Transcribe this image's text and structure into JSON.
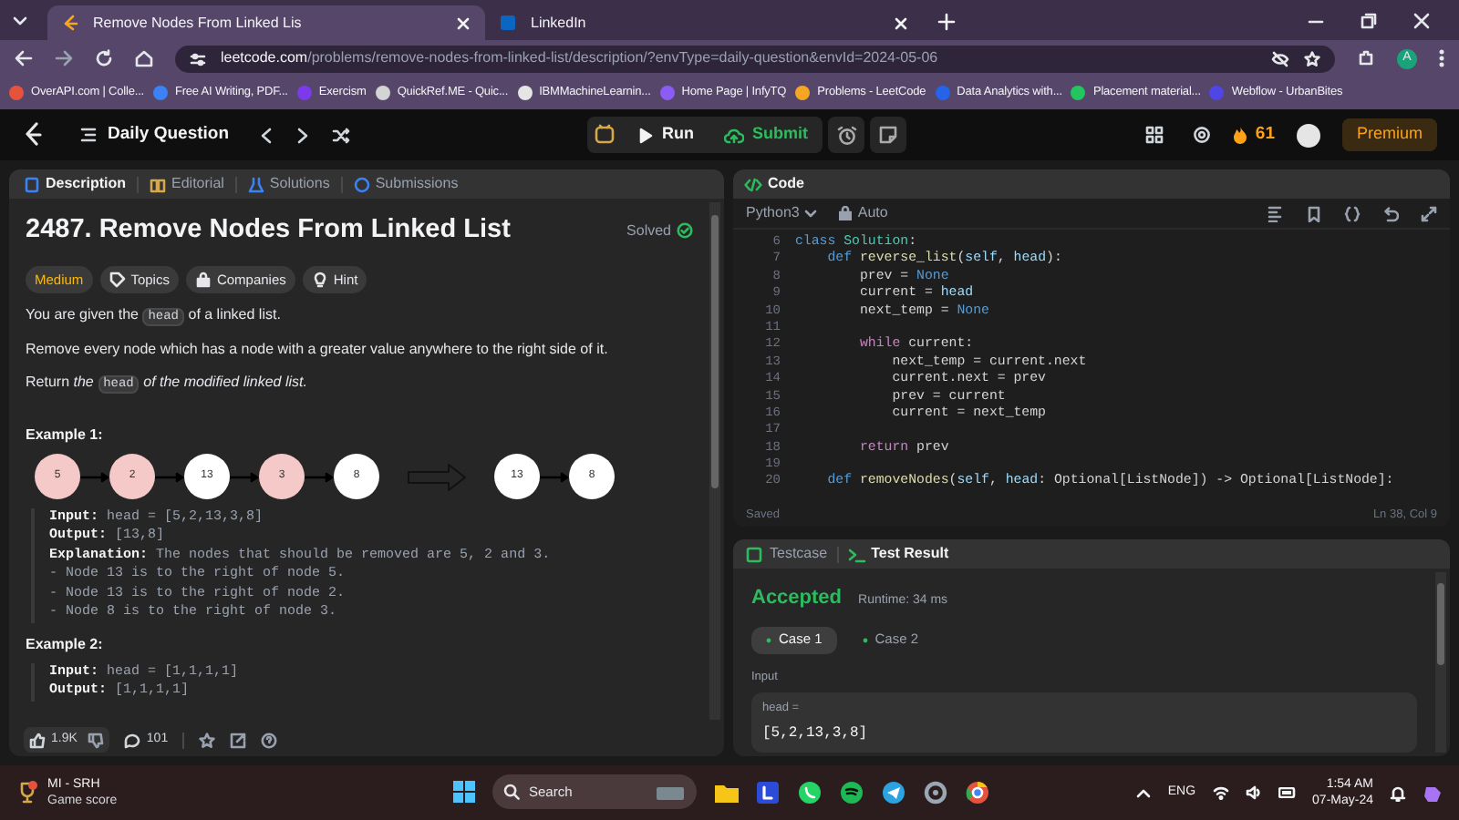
{
  "browser": {
    "tabs": [
      {
        "title": "Remove Nodes From Linked Lis",
        "selected": true
      },
      {
        "title": "LinkedIn",
        "selected": false
      }
    ],
    "url_host": "leetcode.com",
    "url_path": "/problems/remove-nodes-from-linked-list/description/?envType=daily-question&envId=2024-05-06",
    "bookmarks": [
      "OverAPI.com | Colle...",
      "Free AI Writing, PDF...",
      "Exercism",
      "QuickRef.ME - Quic...",
      "IBMMachineLearnin...",
      "Home Page | InfyTQ",
      "Problems - LeetCode",
      "Data Analytics with...",
      "Placement material...",
      "Webflow - UrbanBites"
    ],
    "profile_initial": "A"
  },
  "header": {
    "title": "Daily Question",
    "run": "Run",
    "submit": "Submit",
    "streak": "61",
    "premium": "Premium"
  },
  "left_panel": {
    "tabs": [
      {
        "label": "Description",
        "selected": true
      },
      {
        "label": "Editorial",
        "selected": false
      },
      {
        "label": "Solutions",
        "selected": false
      },
      {
        "label": "Submissions",
        "selected": false
      }
    ],
    "title": "2487. Remove Nodes From Linked List",
    "status": "Solved",
    "tags": [
      {
        "kind": "difficulty",
        "label": "Medium"
      },
      {
        "kind": "topics",
        "label": "Topics"
      },
      {
        "kind": "companies",
        "label": "Companies"
      },
      {
        "kind": "hint",
        "label": "Hint"
      }
    ],
    "paragraphs": [
      [
        {
          "kind": "text",
          "text": "You are given the "
        },
        {
          "kind": "code",
          "text": "head"
        },
        {
          "kind": "text",
          "text": " of a linked list."
        }
      ],
      [
        {
          "kind": "text",
          "text": "Remove every node which has a node with a greater value anywhere to the right side of it."
        }
      ],
      [
        {
          "kind": "text",
          "text": "Return "
        },
        {
          "kind": "italic",
          "text": "the "
        },
        {
          "kind": "code",
          "text": "head"
        },
        {
          "kind": "italic",
          "text": " of the modified linked list."
        }
      ]
    ],
    "examples": [
      {
        "title": "Example 1:",
        "diagram": {
          "input": [
            {
              "value": "5",
              "removed": true
            },
            {
              "value": "2",
              "removed": true
            },
            {
              "value": "13",
              "removed": false
            },
            {
              "value": "3",
              "removed": true
            },
            {
              "value": "8",
              "removed": false
            }
          ],
          "output": [
            {
              "value": "13",
              "removed": false
            },
            {
              "value": "8",
              "removed": false
            }
          ]
        },
        "lines": [
          {
            "label": "Input:",
            "text": "head = [5,2,13,3,8]"
          },
          {
            "label": "Output:",
            "text": "[13,8]"
          },
          {
            "label": "Explanation:",
            "text": "The nodes that should be removed are 5, 2 and 3."
          },
          {
            "text": "- Node 13 is to the right of node 5."
          },
          {
            "text": "- Node 13 is to the right of node 2."
          },
          {
            "text": "- Node 8 is to the right of node 3."
          }
        ]
      },
      {
        "title": "Example 2:",
        "lines": [
          {
            "label": "Input:",
            "text": "head = [1,1,1,1]"
          },
          {
            "label": "Output:",
            "text": "[1,1,1,1]"
          }
        ]
      }
    ],
    "likes": "1.9K",
    "comments": "101"
  },
  "code_panel": {
    "title": "Code",
    "language": "Python3",
    "mode": "Auto",
    "lines": [
      {
        "no": "6",
        "tokens": [
          {
            "kind": "keyword",
            "text": "class"
          },
          {
            "kind": "class",
            "text": " Solution"
          },
          {
            "kind": "plain",
            "text": ":"
          }
        ]
      },
      {
        "no": "7",
        "tokens": [
          {
            "kind": "keyword",
            "text": "    def"
          },
          {
            "kind": "function",
            "text": " reverse_list"
          },
          {
            "kind": "plain",
            "text": "("
          },
          {
            "kind": "param",
            "text": "self"
          },
          {
            "kind": "plain",
            "text": ", "
          },
          {
            "kind": "param",
            "text": "head"
          },
          {
            "kind": "plain",
            "text": "):"
          }
        ]
      },
      {
        "no": "8",
        "tokens": [
          {
            "kind": "plain",
            "text": "        prev = "
          },
          {
            "kind": "keyword",
            "text": "None"
          }
        ]
      },
      {
        "no": "9",
        "tokens": [
          {
            "kind": "plain",
            "text": "        current = "
          },
          {
            "kind": "param",
            "text": "head"
          }
        ]
      },
      {
        "no": "10",
        "tokens": [
          {
            "kind": "plain",
            "text": "        next_temp = "
          },
          {
            "kind": "keyword",
            "text": "None"
          }
        ]
      },
      {
        "no": "11"
      },
      {
        "no": "12",
        "tokens": [
          {
            "kind": "control",
            "text": "        while"
          },
          {
            "kind": "plain",
            "text": " current:"
          }
        ]
      },
      {
        "no": "13",
        "tokens": [
          {
            "kind": "plain",
            "text": "            next_temp = current.next"
          }
        ]
      },
      {
        "no": "14",
        "tokens": [
          {
            "kind": "plain",
            "text": "            current.next = prev"
          }
        ]
      },
      {
        "no": "15",
        "tokens": [
          {
            "kind": "plain",
            "text": "            prev = current"
          }
        ]
      },
      {
        "no": "16",
        "tokens": [
          {
            "kind": "plain",
            "text": "            current = next_temp"
          }
        ]
      },
      {
        "no": "17"
      },
      {
        "no": "18",
        "tokens": [
          {
            "kind": "control",
            "text": "        return"
          },
          {
            "kind": "plain",
            "text": " prev"
          }
        ]
      },
      {
        "no": "19"
      },
      {
        "no": "20",
        "tokens": [
          {
            "kind": "keyword",
            "text": "    def"
          },
          {
            "kind": "function",
            "text": " removeNodes"
          },
          {
            "kind": "plain",
            "text": "("
          },
          {
            "kind": "param",
            "text": "self"
          },
          {
            "kind": "plain",
            "text": ", "
          },
          {
            "kind": "param",
            "text": "head"
          },
          {
            "kind": "plain",
            "text": ": Optional[ListNode]) -> Optional[ListNode]:"
          }
        ]
      }
    ],
    "saved": "Saved",
    "cursor": "Ln 38, Col 9"
  },
  "result_panel": {
    "tabs": [
      {
        "label": "Testcase",
        "selected": false
      },
      {
        "label": "Test Result",
        "selected": true
      }
    ],
    "verdict": "Accepted",
    "runtime": "Runtime: 34 ms",
    "cases": [
      {
        "label": "Case 1",
        "selected": true
      },
      {
        "label": "Case 2",
        "selected": false
      }
    ],
    "input_label": "Input",
    "param": "head =",
    "value": "[5,2,13,3,8]"
  },
  "taskbar": {
    "widget_title": "MI - SRH",
    "widget_subtitle": "Game score",
    "search": "Search",
    "language": "ENG",
    "time": "1:54 AM",
    "date": "07-May-24"
  }
}
